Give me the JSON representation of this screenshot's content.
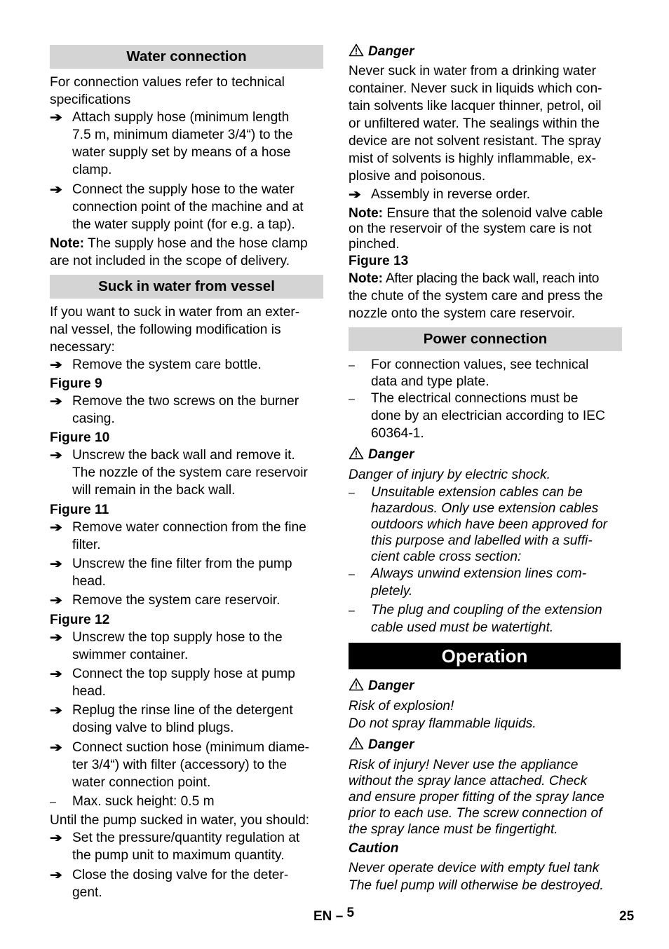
{
  "left_column": {
    "water_connection": {
      "heading": "Water connection",
      "intro": "For connection values refer to technical\nspecifications",
      "steps": [
        "Attach supply hose (minimum length\n7.5 m, minimum diameter 3/4“) to the\nwater supply set by means of a hose\nclamp.",
        "Connect the supply hose to the water\nconnection point of the machine and at\nthe water supply point (for e.g. a tap)."
      ],
      "note_label": "Note:",
      "note_text": " The supply hose and the hose clamp",
      "note_text_2": "are not included in the scope of delivery."
    },
    "suck_in": {
      "heading": "Suck in water from vessel",
      "intro": "If you want to suck in water from an exter-\nnal vessel, the following modification is\nnecessary:",
      "step_1": "Remove the system care bottle.",
      "figure_9": "Figure 9",
      "step_2": "Remove the two screws on the burner\ncasing.",
      "figure_10": "Figure 10",
      "step_3": "Unscrew the back wall and remove it.\nThe nozzle of the system care reservoir\nwill remain in the back wall.",
      "figure_11": "Figure 11",
      "steps_fig11": [
        "Remove water connection from the fine\nfilter.",
        "Unscrew the fine filter from the pump\nhead.",
        "Remove the system care reservoir."
      ],
      "figure_12": "Figure 12",
      "steps_fig12": [
        "Unscrew the top supply hose to the\nswimmer container.",
        "Connect the top supply hose at pump\nhead.",
        "Replug the rinse line of the detergent\ndosing valve to blind plugs.",
        "Connect suction hose (minimum diame-\nter 3/4“) with filter (accessory) to the\nwater connection point."
      ],
      "max_height": "Max. suck height: 0.5 m",
      "until_text": "Until the pump sucked in water, you should:",
      "steps_until": [
        "Set the pressure/quantity regulation at\nthe pump unit to maximum quantity.",
        "Close the dosing valve for the deter-\ngent."
      ]
    }
  },
  "right_column": {
    "danger_1": {
      "label": "Danger",
      "text": "Never suck in water from a drinking water\ncontainer. Never suck in liquids which con-\ntain solvents like lacquer thinner, petrol, oil\nor unfiltered water. The sealings within the\ndevice are not solvent resistant. The spray\nmist of solvents is highly inflammable, ex-\nplosive and poisonous."
    },
    "assembly_step": "Assembly in reverse order.",
    "note_1_label": "Note:",
    "note_1_text": " Ensure that the solenoid valve cable",
    "note_1_text_2": "on the reservoir of the system care is not\npinched.",
    "figure_13": "Figure 13",
    "note_2_label": "Note:",
    "note_2_text": " After placing the back wall, reach into",
    "note_2_text_2": "the chute of the system care and press the\nnozzle onto the system care reservoir.",
    "power_connection": {
      "heading": "Power connection",
      "items": [
        "For connection values, see technical\ndata and type plate.",
        "The electrical connections must be\ndone by an electrician according to IEC\n60364-1."
      ]
    },
    "danger_2": {
      "label": "Danger",
      "intro": "Danger of injury by electric shock.",
      "items": [
        "Unsuitable extension cables can be\nhazardous. Only use extension cables\noutdoors which have been approved for\nthis purpose and labelled with a suffi-\ncient cable cross section:",
        "Always unwind extension lines com-\npletely.",
        "The plug and coupling of the extension\ncable used must be watertight."
      ]
    },
    "operation": {
      "heading": "Operation",
      "danger_3": {
        "label": "Danger",
        "line_1": "Risk of explosion!",
        "line_2": "Do not spray flammable liquids."
      },
      "danger_4": {
        "label": "Danger",
        "text": "Risk of injury! Never use the appliance\nwithout the spray lance attached. Check\nand ensure proper fitting of the spray lance\nprior to each use. The screw connection of\nthe spray lance must be fingertight."
      },
      "caution": {
        "label": "Caution",
        "text": "Never operate device with empty fuel tank\nThe fuel pump will otherwise be destroyed."
      }
    }
  },
  "footer": {
    "lang": "EN",
    "dash": "–",
    "section_page": "5",
    "page_number": "25"
  },
  "icons": {
    "arrow": "➔",
    "dash": "–",
    "warning": "warning-triangle"
  }
}
